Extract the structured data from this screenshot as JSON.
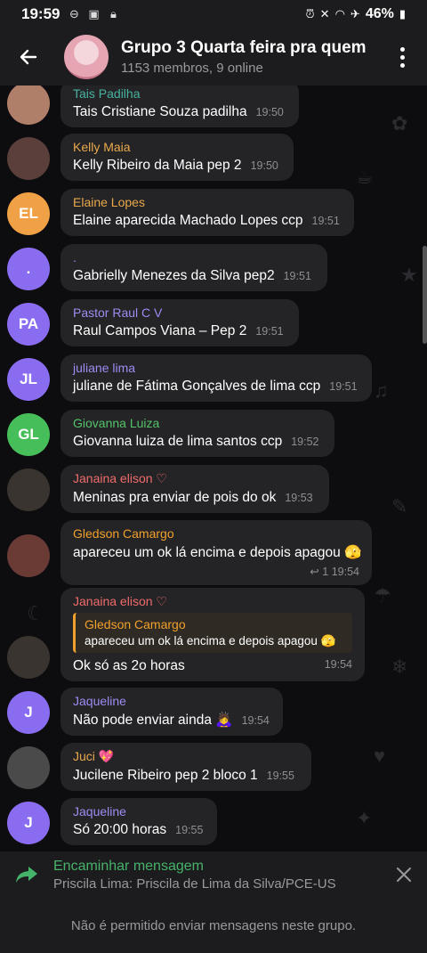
{
  "status": {
    "time": "19:59",
    "battery": "46%"
  },
  "header": {
    "title": "Grupo 3 Quarta feira pra quem",
    "subtitle": "1153 membros, 9 online"
  },
  "messages": [
    {
      "author": "Tais Padilha",
      "author_color": "#46b3a0",
      "text": "Tais Cristiane Souza padilha",
      "time": "19:50",
      "avatar_initials": "",
      "avatar_color": "#b07f6a"
    },
    {
      "author": "Kelly Maia",
      "author_color": "#e9a94b",
      "text": "Kelly Ribeiro da Maia pep 2",
      "time": "19:50",
      "avatar_initials": "",
      "avatar_color": "#5a3f3a"
    },
    {
      "author": "Elaine Lopes",
      "author_color": "#e9a94b",
      "text": "Elaine aparecida Machado Lopes ccp",
      "time": "19:51",
      "avatar_initials": "EL",
      "avatar_color": "#f0a145"
    },
    {
      "author": ".",
      "author_color": "#8e8ef0",
      "text": "Gabrielly Menezes da Silva pep2",
      "time": "19:51",
      "avatar_initials": ".",
      "avatar_color": "#8a6cf0"
    },
    {
      "author": "Pastor Raul C V",
      "author_color": "#9d8cf2",
      "text": "Raul Campos Viana  – Pep 2",
      "time": "19:51",
      "avatar_initials": "PA",
      "avatar_color": "#8a6cf0"
    },
    {
      "author": "juliane lima",
      "author_color": "#9d8cf2",
      "text": "juliane de Fátima Gonçalves de lima ccp",
      "time": "19:51",
      "avatar_initials": "JL",
      "avatar_color": "#8a6cf0"
    },
    {
      "author": "Giovanna Luiza",
      "author_color": "#54c36a",
      "text": "Giovanna luiza de lima santos ccp",
      "time": "19:52",
      "avatar_initials": "GL",
      "avatar_color": "#46bf5a"
    },
    {
      "author": "Janaina elison ♡",
      "author_color": "#ef6b6b",
      "text": "Meninas pra enviar de pois do ok",
      "time": "19:53",
      "avatar_initials": "",
      "avatar_color": "#3a3430"
    },
    {
      "author": "Gledson Camargo",
      "author_color": "#f0a02c",
      "text": "apareceu um ok lá encima e depois apagou 🫣",
      "time": "19:54",
      "reply_count": "1",
      "avatar_initials": "",
      "avatar_color": "#6a3a34"
    },
    {
      "author": "Janaina elison ♡",
      "author_color": "#ef6b6b",
      "reply_author": "Gledson Camargo",
      "reply_text": "apareceu um ok lá encima e depois apagou 🫣",
      "text": "Ok só as 2o horas",
      "time": "19:54",
      "avatar_initials": "",
      "avatar_color": "#3a3430"
    },
    {
      "author": "Jaqueline",
      "author_color": "#9d8cf2",
      "text": "Não pode enviar ainda 🙇‍♀️",
      "time": "19:54",
      "avatar_initials": "J",
      "avatar_color": "#8a6cf0"
    },
    {
      "author": "Juci 💖",
      "author_color": "#e9a94b",
      "text": "Jucilene Ribeiro pep 2 bloco 1",
      "time": "19:55",
      "avatar_initials": "",
      "avatar_color": "#4a4a4a"
    },
    {
      "author": "Jaqueline",
      "author_color": "#9d8cf2",
      "text": "Só 20:00 horas",
      "time": "19:55",
      "avatar_initials": "J",
      "avatar_color": "#8a6cf0"
    }
  ],
  "forward": {
    "title": "Encaminhar mensagem",
    "subtitle": "Priscila Lima: Priscila de Lima da Silva/PCE-US"
  },
  "footer": {
    "notice": "Não é permitido enviar mensagens neste grupo."
  },
  "icons": {
    "back": "arrow-left-icon",
    "menu": "more-vert-icon",
    "forward": "forward-arrow-icon",
    "close": "close-icon"
  }
}
